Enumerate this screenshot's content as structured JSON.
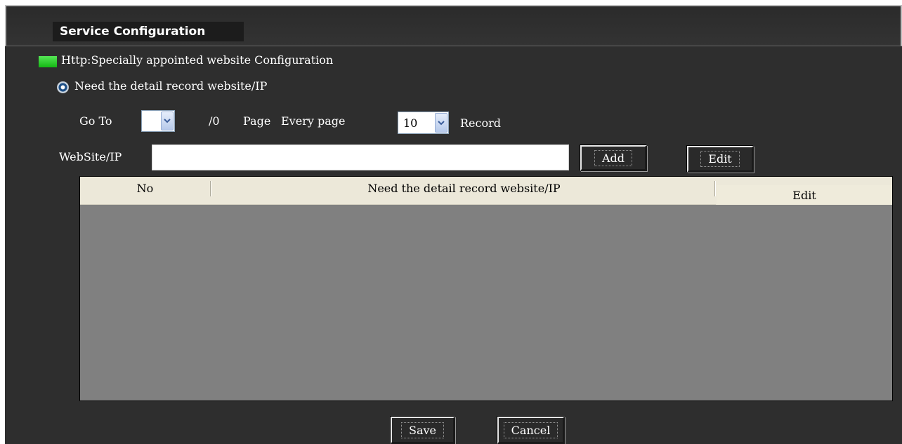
{
  "header": {
    "title": "Service Configuration"
  },
  "section": {
    "title": "Http:Specially appointed website  Configuration",
    "marker_color": "#22c822"
  },
  "option": {
    "radio_label": "Need the detail record website/IP",
    "selected": true
  },
  "pagination": {
    "goto_label": "Go To",
    "goto_value": "",
    "total_pages": "/0",
    "page_label": "Page",
    "every_page_label": "Every page",
    "per_page_value": "10",
    "record_label": "Record"
  },
  "website": {
    "label": "WebSite/IP",
    "value": "",
    "add_label": "Add",
    "edit_label": "Edit"
  },
  "table": {
    "columns": [
      "No",
      "Need the detail record website/IP",
      "Edit"
    ],
    "rows": []
  },
  "footer": {
    "save_label": "Save",
    "cancel_label": "Cancel"
  },
  "colors": {
    "background": "#2e2e2e",
    "table_body": "#808080",
    "table_header": "#ece8d9"
  }
}
